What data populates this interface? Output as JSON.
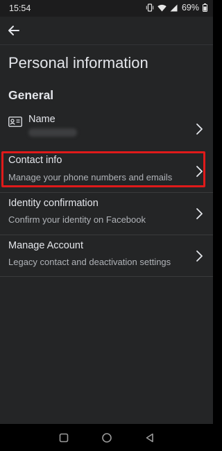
{
  "status_bar": {
    "time": "15:54",
    "battery": "69%"
  },
  "page": {
    "title": "Personal information",
    "section": "General"
  },
  "rows": {
    "name": {
      "title": "Name"
    },
    "contact": {
      "title": "Contact info",
      "subtitle": "Manage your phone numbers and emails"
    },
    "identity": {
      "title": "Identity confirmation",
      "subtitle": "Confirm your identity on Facebook"
    },
    "manage": {
      "title": "Manage Account",
      "subtitle": "Legacy contact and deactivation settings"
    }
  },
  "colors": {
    "background": "#242526",
    "highlight": "#e01a1a",
    "text_primary": "#e4e6eb",
    "text_secondary": "#b0b3b8"
  }
}
